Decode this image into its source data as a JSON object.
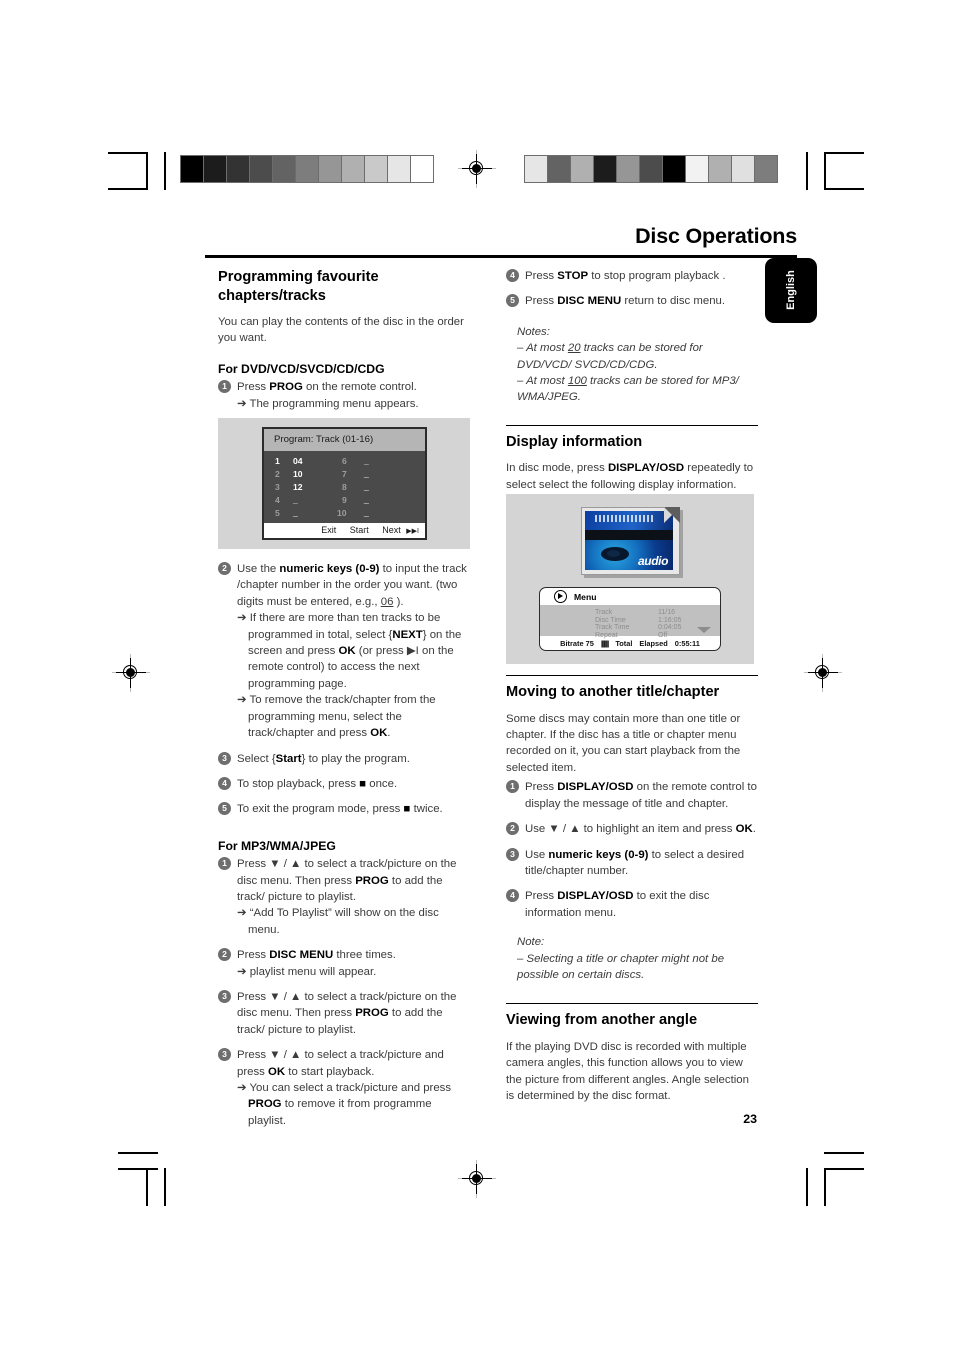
{
  "header": {
    "doc_title": "Disc Operations",
    "language_tab": "English",
    "page_number": "23"
  },
  "left_column": {
    "section1": {
      "heading": "Programming favourite chapters/tracks",
      "intro": "You can play the contents of the disc in the order you want.",
      "subheading": "For DVD/VCD/SVCD/CD/CDG",
      "steps": [
        {
          "num": "1",
          "text_pre": "Press ",
          "bold": "PROG",
          "text_post": " on the remote control.",
          "sub": "➔ The programming menu appears."
        },
        {
          "num": "2",
          "line1_pre": "Use the ",
          "line1_bold": "numeric keys (0-9)",
          "line1_post": " to input the track /chapter number in the order you want. (two digits must be entered, e.g., ",
          "line1_underline": "06",
          "line1_end": " ).",
          "sub1_a": "➔ If there are more than ten tracks to be programmed in total, select {",
          "sub1_bold1": "NEXT",
          "sub1_b": "} on the screen and press ",
          "sub1_bold2": "OK",
          "sub1_c": " (or press ▶I on the remote control) to access the next programming page.",
          "sub2_a": "➔ To remove the track/chapter from the programming menu, select the track/chapter and press ",
          "sub2_bold": "OK",
          "sub2_b": "."
        },
        {
          "num": "3",
          "text_pre": "Select {",
          "bold": "Start",
          "text_post": "} to play the program."
        },
        {
          "num": "4",
          "text_pre": "To stop playback, press ",
          "bold": "■",
          "text_post": " once."
        },
        {
          "num": "5",
          "text_pre": "To exit the program mode, press ",
          "bold": "■",
          "text_post": " twice."
        }
      ],
      "subheading2": "For MP3/WMA/JPEG",
      "steps2": [
        {
          "num": "1",
          "line_a": "Press ▼ / ▲ to select a track/picture on the disc menu. Then press ",
          "line_bold": "PROG",
          "line_b": " to add the track/ picture to playlist.",
          "sub": "➔ “Add To Playlist” will show on the disc menu."
        },
        {
          "num": "2",
          "line_a": "Press ",
          "line_bold": "DISC MENU",
          "line_b": " three times.",
          "sub": "➔ playlist menu will appear."
        },
        {
          "num": "3",
          "line_a": "Press ▼ / ▲ to select a track/picture on the disc menu. Then press ",
          "line_bold": "PROG",
          "line_b": " to add the track/ picture to playlist."
        },
        {
          "num": "3",
          "line_a": "Press ▼ / ▲ to select a track/picture and press ",
          "line_bold": "OK",
          "line_b": " to start playback.",
          "sub_a": "➔ You can select a track/picture and press ",
          "sub_bold": "PROG",
          "sub_b": " to remove it from programme playlist."
        }
      ]
    }
  },
  "program_figure": {
    "title": "Program: Track (01-16)",
    "entries_left": [
      {
        "index": "1",
        "value": "04",
        "empty": false
      },
      {
        "index": "2",
        "value": "10",
        "empty": false
      },
      {
        "index": "3",
        "value": "12",
        "empty": false
      },
      {
        "index": "4",
        "value": "_ _",
        "empty": true
      },
      {
        "index": "5",
        "value": "_ _",
        "empty": true
      }
    ],
    "entries_right": [
      {
        "index": "6",
        "value": "_ _",
        "empty": true
      },
      {
        "index": "7",
        "value": "_ _",
        "empty": true
      },
      {
        "index": "8",
        "value": "_ _",
        "empty": true
      },
      {
        "index": "9",
        "value": "_ _",
        "empty": true
      },
      {
        "index": "10",
        "value": "_ _",
        "empty": true
      }
    ],
    "footer": {
      "exit": "Exit",
      "start": "Start",
      "next": "Next",
      "next_icon": "▶▶I"
    }
  },
  "right_column": {
    "steps_top": [
      {
        "num": "4",
        "text_pre": "Press ",
        "bold": "STOP",
        "text_post": " to stop program playback ."
      },
      {
        "num": "5",
        "text_pre": "Press ",
        "bold": "DISC MENU",
        "text_post": " return to disc menu."
      }
    ],
    "notes1": {
      "label": "Notes:",
      "line1_a": "–  At most ",
      "line1_u": "20",
      "line1_b": "  tracks can be stored for DVD/VCD/ SVCD/CD/CDG.",
      "line2_a": "–  At most ",
      "line2_u": "100",
      "line2_b": " tracks can be stored for MP3/ WMA/JPEG."
    },
    "section_display": {
      "heading": "Display information",
      "body_a": "In disc mode, press ",
      "body_bold": "DISPLAY/OSD",
      "body_b": " repeatedly to select select the following display information."
    },
    "section_moving": {
      "heading": "Moving to another title/chapter",
      "intro": "Some discs may contain more than one title or chapter. If the disc has a title or chapter menu recorded on it, you can start playback from the selected item.",
      "steps": [
        {
          "num": "1",
          "text_pre": "Press ",
          "bold": "DISPLAY/OSD",
          "text_post": " on the remote control to display the message of title and chapter."
        },
        {
          "num": "2",
          "text_pre": "Use ▼ / ▲ to highlight an item and press ",
          "bold": "OK",
          "text_post": "."
        },
        {
          "num": "3",
          "text_pre": "Use ",
          "bold": "numeric keys (0-9)",
          "text_post": " to select a desired title/chapter number."
        },
        {
          "num": "4",
          "text_pre": "Press ",
          "bold": "DISPLAY/OSD",
          "text_post": " to exit the disc information menu."
        }
      ]
    },
    "note2": {
      "label": "Note:",
      "text": "–  Selecting a title or chapter might not be possible on certain discs."
    },
    "section_angle": {
      "heading": "Viewing from another angle",
      "body": "If the playing DVD disc is recorded with multiple camera angles, this function allows you to view the picture from different angles. Angle selection is determined by the disc format."
    }
  },
  "display_figure": {
    "disc_label": "audio",
    "osd": {
      "menu_label": "Menu",
      "rows": [
        {
          "label": "Track",
          "value": "11/16"
        },
        {
          "label": "Disc Time",
          "value": "1:16:05"
        },
        {
          "label": "Track Time",
          "value": "0:04:05"
        },
        {
          "label": "Repeat",
          "value": "Off"
        }
      ],
      "status": {
        "bitrate_label": "Bitrate 75",
        "bars": "|||||||",
        "total": "Total",
        "elapsed": "Elapsed",
        "time": "0:55:11"
      }
    }
  },
  "print_marks": {
    "wedge_left": [
      "#000000",
      "#1c1c1c",
      "#333333",
      "#4c4c4c",
      "#636363",
      "#7d7d7d",
      "#969696",
      "#b0b0b0",
      "#c9c9c9",
      "#e6e6e6",
      "#ffffff"
    ],
    "wedge_right": [
      "#e6e6e6",
      "#636363",
      "#b0b0b0",
      "#1c1c1c",
      "#969696",
      "#4c4c4c",
      "#000000",
      "#f2f2f2",
      "#b0b0b0",
      "#e0e0e0",
      "#7d7d7d"
    ]
  }
}
